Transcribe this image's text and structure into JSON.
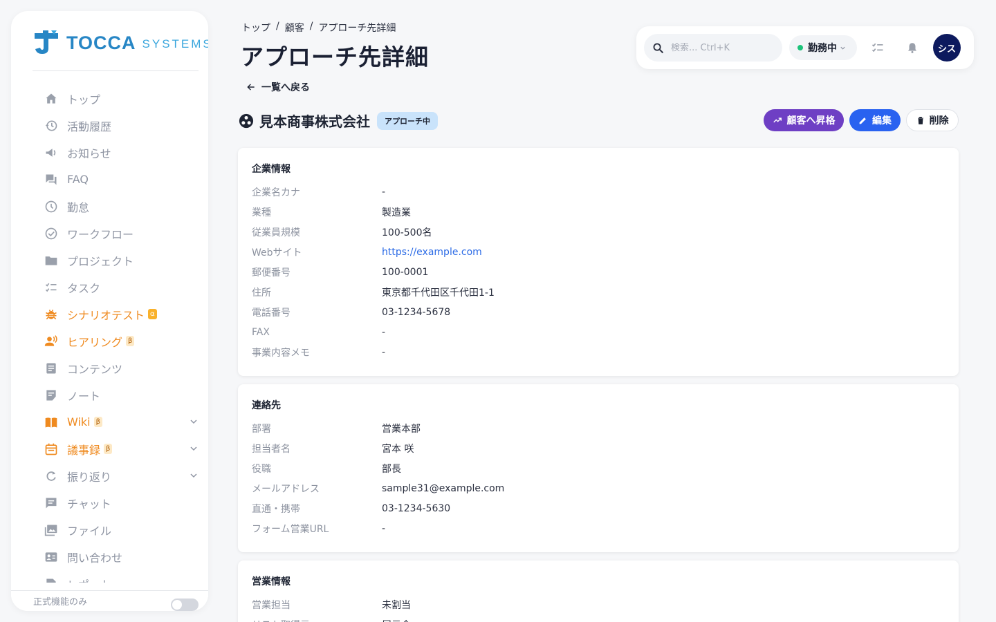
{
  "logo": {
    "text": "TOCCA",
    "sub": "SYSTEMS"
  },
  "sidebar": {
    "items": [
      {
        "label": "トップ",
        "icon": "home-icon",
        "color": "gray"
      },
      {
        "label": "活動履歴",
        "icon": "history-icon",
        "color": "gray"
      },
      {
        "label": "お知らせ",
        "icon": "megaphone-icon",
        "color": "gray"
      },
      {
        "label": "FAQ",
        "icon": "forum-icon",
        "color": "gray"
      },
      {
        "label": "勤怠",
        "icon": "clock-icon",
        "color": "gray"
      },
      {
        "label": "ワークフロー",
        "icon": "check-circle-icon",
        "color": "gray"
      },
      {
        "label": "プロジェクト",
        "icon": "folder-icon",
        "color": "gray"
      },
      {
        "label": "タスク",
        "icon": "checklist-icon",
        "color": "gray"
      },
      {
        "label": "シナリオテスト",
        "icon": "bug-icon",
        "color": "orange",
        "badge": "α"
      },
      {
        "label": "ヒアリング",
        "icon": "voice-icon",
        "color": "orange",
        "badge": "β"
      },
      {
        "label": "コンテンツ",
        "icon": "article-icon",
        "color": "gray"
      },
      {
        "label": "ノート",
        "icon": "note-icon",
        "color": "gray"
      },
      {
        "label": "Wiki",
        "icon": "book-icon",
        "color": "orange",
        "badge": "β",
        "expandable": true
      },
      {
        "label": "議事録",
        "icon": "calendar-icon",
        "color": "orange",
        "badge": "β",
        "expandable": true
      },
      {
        "label": "振り返り",
        "icon": "refresh-icon",
        "color": "gray",
        "expandable": true
      },
      {
        "label": "チャット",
        "icon": "chat-icon",
        "color": "gray"
      },
      {
        "label": "ファイル",
        "icon": "image-icon",
        "color": "gray"
      },
      {
        "label": "問い合わせ",
        "icon": "contact-card-icon",
        "color": "gray"
      },
      {
        "label": "レポート",
        "icon": "report-icon",
        "color": "gray"
      }
    ],
    "footer_label": "正式機能のみ"
  },
  "header": {
    "breadcrumb": [
      "トップ",
      "顧客",
      "アプローチ先詳細"
    ],
    "title": "アプローチ先詳細",
    "search_placeholder": "検索... Ctrl+K",
    "status_label": "勤務中",
    "avatar_text": "シス"
  },
  "back_label": "一覧へ戻る",
  "company": {
    "name": "見本商事株式会社",
    "status": "アプローチ中"
  },
  "actions": {
    "promote": "顧客へ昇格",
    "edit": "編集",
    "delete": "削除"
  },
  "sections": [
    {
      "title": "企業情報",
      "rows": [
        {
          "label": "企業名カナ",
          "value": "-"
        },
        {
          "label": "業種",
          "value": "製造業"
        },
        {
          "label": "従業員規模",
          "value": "100-500名"
        },
        {
          "label": "Webサイト",
          "value": "https://example.com",
          "link": true
        },
        {
          "label": "郵便番号",
          "value": "100-0001"
        },
        {
          "label": "住所",
          "value": "東京都千代田区千代田1-1"
        },
        {
          "label": "電話番号",
          "value": "03-1234-5678"
        },
        {
          "label": "FAX",
          "value": "-"
        },
        {
          "label": "事業内容メモ",
          "value": "-"
        }
      ]
    },
    {
      "title": "連絡先",
      "rows": [
        {
          "label": "部署",
          "value": "営業本部"
        },
        {
          "label": "担当者名",
          "value": "宮本 咲"
        },
        {
          "label": "役職",
          "value": "部長"
        },
        {
          "label": "メールアドレス",
          "value": "sample31@example.com"
        },
        {
          "label": "直通・携帯",
          "value": "03-1234-5630"
        },
        {
          "label": "フォーム営業URL",
          "value": "-"
        }
      ]
    },
    {
      "title": "営業情報",
      "rows": [
        {
          "label": "営業担当",
          "value": "未割当"
        },
        {
          "label": "リスト取得元",
          "value": "展示会"
        }
      ]
    }
  ],
  "colors": {
    "accent_blue": "#2962f0",
    "promote_purple": "#6e3fc4",
    "brand": "#2786c5",
    "orange": "#ef8a1f"
  }
}
